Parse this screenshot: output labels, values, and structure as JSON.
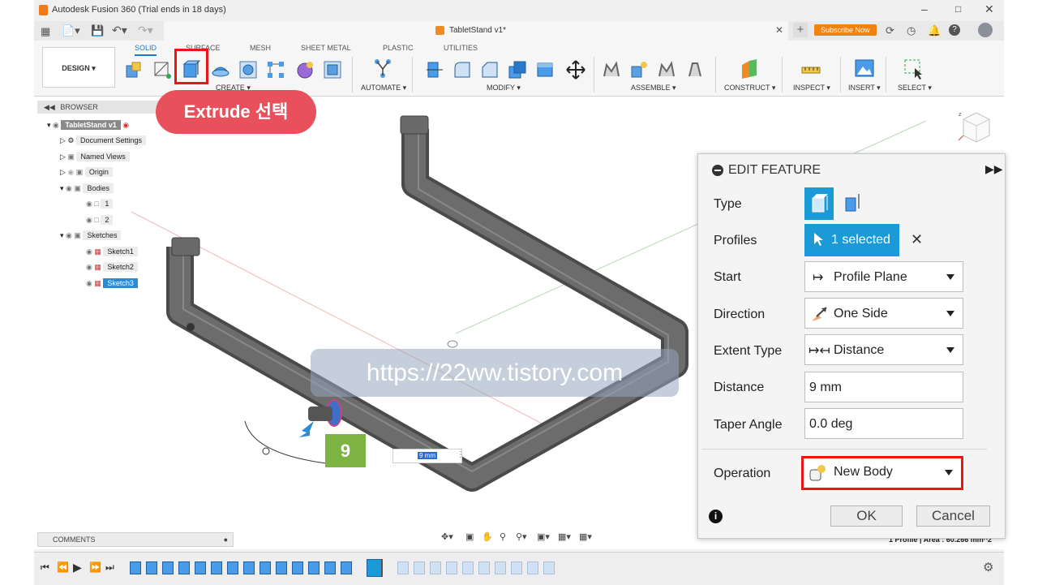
{
  "window": {
    "title": "Autodesk Fusion 360 (Trial ends in 18 days)"
  },
  "tabbar": {
    "doc_tab": "TabletStand v1*",
    "subscribe": "Subscribe Now"
  },
  "ribbon": {
    "workspace": "DESIGN ▾",
    "tabs": [
      "SOLID",
      "SURFACE",
      "MESH",
      "SHEET METAL",
      "PLASTIC",
      "UTILITIES"
    ],
    "groups": [
      "CREATE ▾",
      "AUTOMATE ▾",
      "MODIFY ▾",
      "ASSEMBLE ▾",
      "CONSTRUCT ▾",
      "INSPECT ▾",
      "INSERT ▾",
      "SELECT ▾"
    ]
  },
  "annotation": {
    "extrude_callout": "Extrude 선택",
    "step_number": "9",
    "watermark": "https://22ww.tistory.com"
  },
  "browser": {
    "title": "BROWSER",
    "items": [
      {
        "label": "TabletStand v1"
      },
      {
        "label": "Document Settings"
      },
      {
        "label": "Named Views"
      },
      {
        "label": "Origin"
      },
      {
        "label": "Bodies"
      },
      {
        "label": "1"
      },
      {
        "label": "2"
      },
      {
        "label": "Sketches"
      },
      {
        "label": "Sketch1"
      },
      {
        "label": "Sketch2"
      },
      {
        "label": "Sketch3"
      }
    ]
  },
  "comments": {
    "title": "COMMENTS"
  },
  "viewport": {
    "distance_input": "9 mm",
    "status": "1 Profile | Area : 60.266 mm^2"
  },
  "edit_feature": {
    "title": "EDIT FEATURE",
    "type_label": "Type",
    "profiles_label": "Profiles",
    "profiles_value": "1 selected",
    "start_label": "Start",
    "start_value": "Profile Plane",
    "direction_label": "Direction",
    "direction_value": "One Side",
    "extent_label": "Extent Type",
    "extent_value": "Distance",
    "distance_label": "Distance",
    "distance_value": "9 mm",
    "taper_label": "Taper Angle",
    "taper_value": "0.0 deg",
    "operation_label": "Operation",
    "operation_value": "New Body",
    "ok": "OK",
    "cancel": "Cancel"
  },
  "colors": {
    "accent": "#1a7bd0",
    "highlight": "#e81616",
    "callout": "#e8505b",
    "step": "#7cb342",
    "subscribe": "#f0820f"
  }
}
